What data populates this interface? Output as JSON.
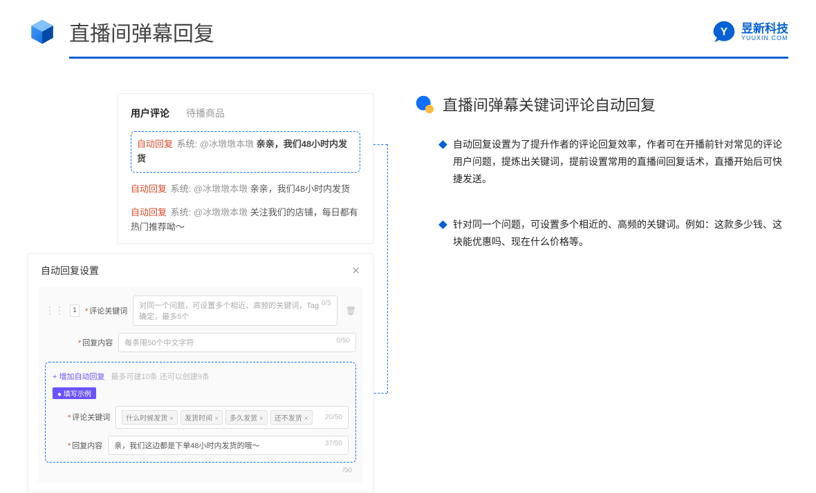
{
  "header": {
    "title": "直播间弹幕回复",
    "logo_top": "昱新科技",
    "logo_sub": "YUUXIN.COM"
  },
  "comments": {
    "tab_active": "用户评论",
    "tab_other": "待播商品",
    "tag_reply": "自动回复",
    "sys_label": "系统:",
    "msg1_user": "@冰墩墩本墩",
    "msg1_text": "亲亲，我们48小时内发货",
    "msg2_user": "@冰墩墩本墩",
    "msg2_text": "亲亲，我们48小时内发货",
    "msg3_user": "@冰墩墩本墩",
    "msg3_text": "关注我们的店铺，每日都有热门推荐呦～"
  },
  "settings": {
    "title": "自动回复设置",
    "idx": "1",
    "lbl_keyword": "评论关键词",
    "ph_keyword": "对同一个问题，可设置多个相近、高频的关键词，Tag确定，最多5个",
    "count_keyword": "0/5",
    "lbl_content": "回复内容",
    "ph_content": "每条限50个中文字符",
    "count_content": "0/50",
    "add_link": "+ 增加自动回复",
    "add_desc": "最多可建10条 还可以创建9条",
    "example_badge": "● 填写示例",
    "ex_lbl_kw": "评论关键词",
    "ex_tags": [
      "什么时候发货",
      "发货时间",
      "多久发货",
      "还不发货"
    ],
    "ex_count_kw": "20/50",
    "ex_lbl_ct": "回复内容",
    "ex_content": "亲，我们这边都是下单48小时内发货的哦～",
    "ex_count_ct": "37/50",
    "outer_count": "/50"
  },
  "right": {
    "title": "直播间弹幕关键词评论自动回复",
    "p1": "自动回复设置为了提升作者的评论回复效率，作者可在开播前针对常见的评论用户问题，提炼出关键词，提前设置常用的直播间回复话术，直播开始后可快捷发送。",
    "p2": "针对同一个问题，可设置多个相近的、高频的关键词。例如：这款多少钱、这块能优惠吗、现在什么价格等。"
  }
}
